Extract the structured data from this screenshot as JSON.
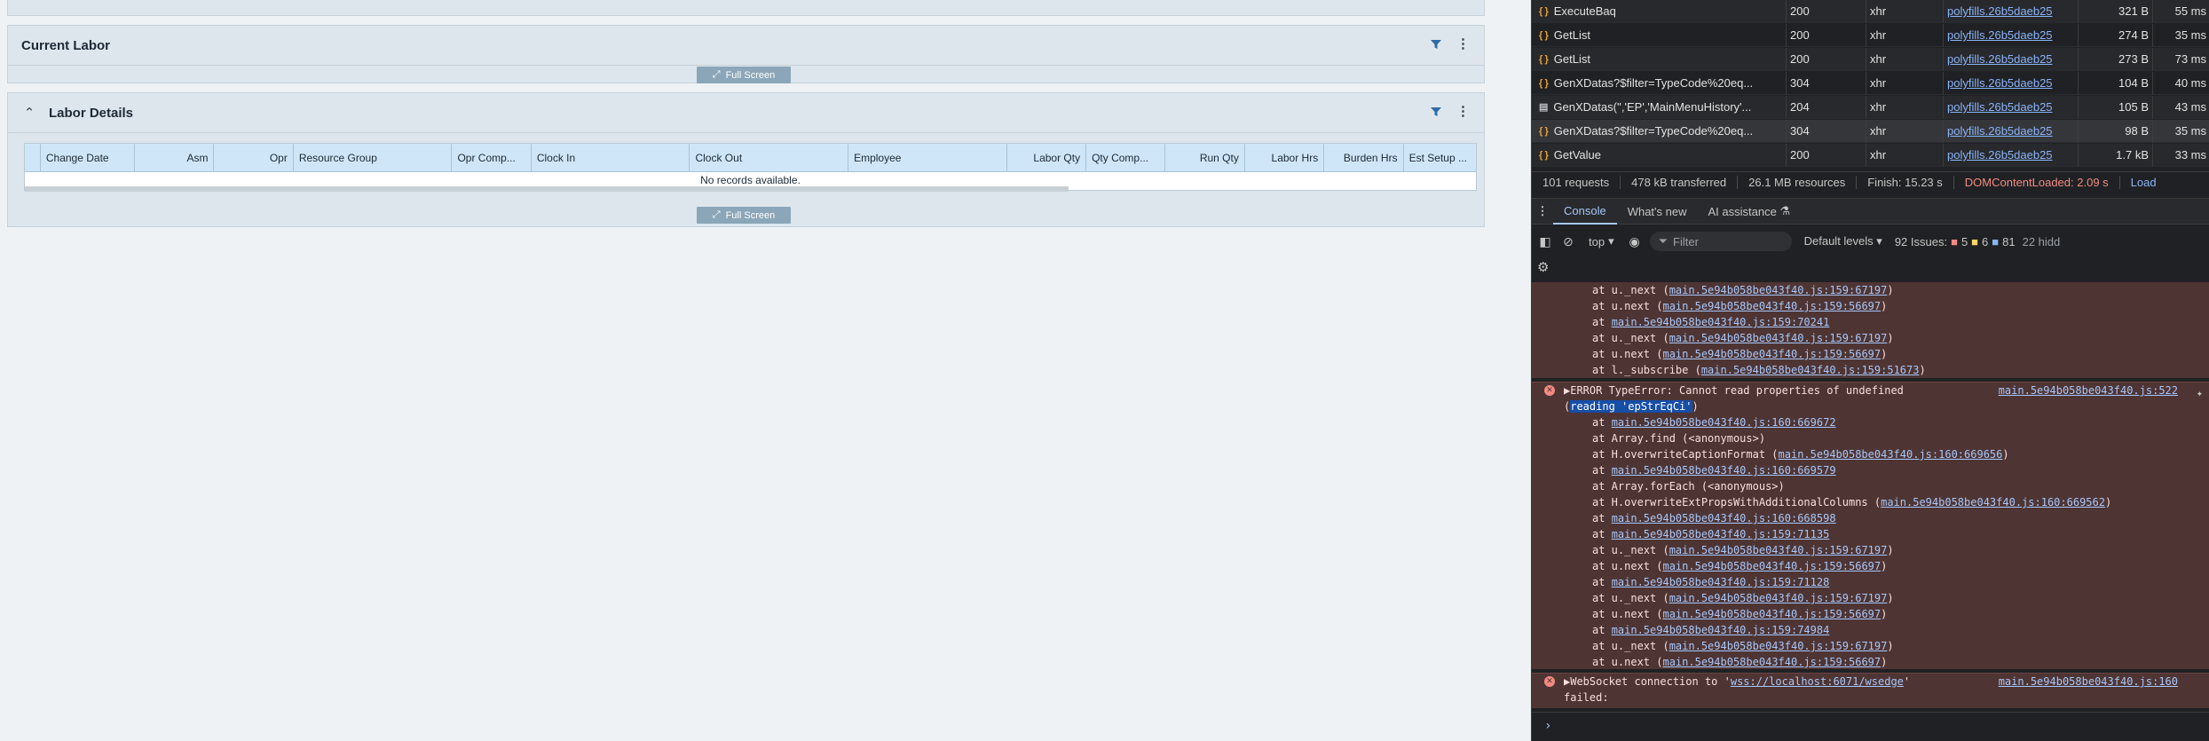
{
  "app": {
    "current_labor": {
      "title": "Current Labor",
      "fullscreen_label": "Full Screen"
    },
    "labor_details": {
      "title": "Labor Details",
      "fullscreen_label": "Full Screen",
      "columns": [
        "Change Date",
        "Asm",
        "Opr",
        "Resource Group",
        "Opr Comp...",
        "Clock In",
        "Clock Out",
        "Employee",
        "Labor Qty",
        "Qty Comp...",
        "Run Qty",
        "Labor Hrs",
        "Burden Hrs",
        "Est Setup ..."
      ],
      "empty_text": "No records available."
    },
    "icons": {
      "filter": "filter-icon",
      "menu": "kebab-menu-icon",
      "collapse": "chevron-up-icon",
      "fullscreen": "expand-icon"
    }
  },
  "devtools": {
    "network_rows": [
      {
        "name": "ExecuteBaq",
        "status": "200",
        "type": "xhr",
        "initiator": "polyfills.26b5daeb25",
        "size": "321 B",
        "time": "55 ms"
      },
      {
        "name": "GetList",
        "status": "200",
        "type": "xhr",
        "initiator": "polyfills.26b5daeb25",
        "size": "274 B",
        "time": "35 ms"
      },
      {
        "name": "GetList",
        "status": "200",
        "type": "xhr",
        "initiator": "polyfills.26b5daeb25",
        "size": "273 B",
        "time": "73 ms"
      },
      {
        "name": "GenXDatas?$filter=TypeCode%20eq...",
        "status": "304",
        "type": "xhr",
        "initiator": "polyfills.26b5daeb25",
        "size": "104 B",
        "time": "40 ms"
      },
      {
        "name": "GenXDatas('','EP','MainMenuHistory'...",
        "status": "204",
        "type": "xhr",
        "initiator": "polyfills.26b5daeb25",
        "size": "105 B",
        "time": "43 ms"
      },
      {
        "name": "GenXDatas?$filter=TypeCode%20eq...",
        "status": "304",
        "type": "xhr",
        "initiator": "polyfills.26b5daeb25",
        "size": "98 B",
        "time": "35 ms"
      },
      {
        "name": "GetValue",
        "status": "200",
        "type": "xhr",
        "initiator": "polyfills.26b5daeb25",
        "size": "1.7 kB",
        "time": "33 ms"
      }
    ],
    "summary": {
      "requests": "101 requests",
      "transferred": "478 kB transferred",
      "resources": "26.1 MB resources",
      "finish": "Finish: 15.23 s",
      "dcl": "DOMContentLoaded: 2.09 s",
      "load": "Load"
    },
    "drawer_tabs": {
      "more": "⋮",
      "console": "Console",
      "whats_new": "What's new",
      "ai": "AI assistance"
    },
    "toolbar": {
      "context": "top",
      "filter_placeholder": "Filter",
      "levels": "Default levels",
      "issues_label": "92 Issues:",
      "issues_errors": "5",
      "issues_warnings": "6",
      "issues_info": "81",
      "hidden": "22 hidd"
    },
    "console": {
      "trace1": [
        {
          "pre": "at u._next (",
          "link": "main.5e94b058be043f40.js:159:67197",
          "post": ")"
        },
        {
          "pre": "at u.next (",
          "link": "main.5e94b058be043f40.js:159:56697",
          "post": ")"
        },
        {
          "pre": "at ",
          "link": "main.5e94b058be043f40.js:159:70241",
          "post": ""
        },
        {
          "pre": "at u._next (",
          "link": "main.5e94b058be043f40.js:159:67197",
          "post": ")"
        },
        {
          "pre": "at u.next (",
          "link": "main.5e94b058be043f40.js:159:56697",
          "post": ")"
        },
        {
          "pre": "at l._subscribe (",
          "link": "main.5e94b058be043f40.js:159:51673",
          "post": ")"
        }
      ],
      "error2": {
        "head": "▶ERROR TypeError: Cannot read properties of undefined",
        "source": "main.5e94b058be043f40.js:522",
        "cont_pre": "(",
        "cont_hl": "reading 'epStrEqCi'",
        "cont_post": ")"
      },
      "trace2": [
        {
          "pre": "at ",
          "link": "main.5e94b058be043f40.js:160:669672",
          "post": ""
        },
        {
          "pre": "at Array.find (<anonymous>)",
          "link": "",
          "post": ""
        },
        {
          "pre": "at H.overwriteCaptionFormat (",
          "link": "main.5e94b058be043f40.js:160:669656",
          "post": ")"
        },
        {
          "pre": "at ",
          "link": "main.5e94b058be043f40.js:160:669579",
          "post": ""
        },
        {
          "pre": "at Array.forEach (<anonymous>)",
          "link": "",
          "post": ""
        },
        {
          "pre": "at H.overwriteExtPropsWithAdditionalColumns (",
          "link": "main.5e94b058be043f40.js:160:669562",
          "post": ")"
        },
        {
          "pre": "at ",
          "link": "main.5e94b058be043f40.js:160:668598",
          "post": ""
        },
        {
          "pre": "at ",
          "link": "main.5e94b058be043f40.js:159:71135",
          "post": ""
        },
        {
          "pre": "at u._next (",
          "link": "main.5e94b058be043f40.js:159:67197",
          "post": ")"
        },
        {
          "pre": "at u.next (",
          "link": "main.5e94b058be043f40.js:159:56697",
          "post": ")"
        },
        {
          "pre": "at ",
          "link": "main.5e94b058be043f40.js:159:71128",
          "post": ""
        },
        {
          "pre": "at u._next (",
          "link": "main.5e94b058be043f40.js:159:67197",
          "post": ")"
        },
        {
          "pre": "at u.next (",
          "link": "main.5e94b058be043f40.js:159:56697",
          "post": ")"
        },
        {
          "pre": "at ",
          "link": "main.5e94b058be043f40.js:159:74984",
          "post": ""
        },
        {
          "pre": "at u._next (",
          "link": "main.5e94b058be043f40.js:159:67197",
          "post": ")"
        },
        {
          "pre": "at u.next (",
          "link": "main.5e94b058be043f40.js:159:56697",
          "post": ")"
        }
      ],
      "error3": {
        "head_pre": "▶WebSocket connection to '",
        "head_link": "wss://localhost:6071/wsedge",
        "head_post": "'",
        "source": "main.5e94b058be043f40.js:160",
        "cont": "failed:"
      },
      "prompt": "›"
    },
    "colors": {
      "error_bg": "#4e3534",
      "link": "#a8c7fa",
      "accent": "#8ab4f8"
    }
  }
}
